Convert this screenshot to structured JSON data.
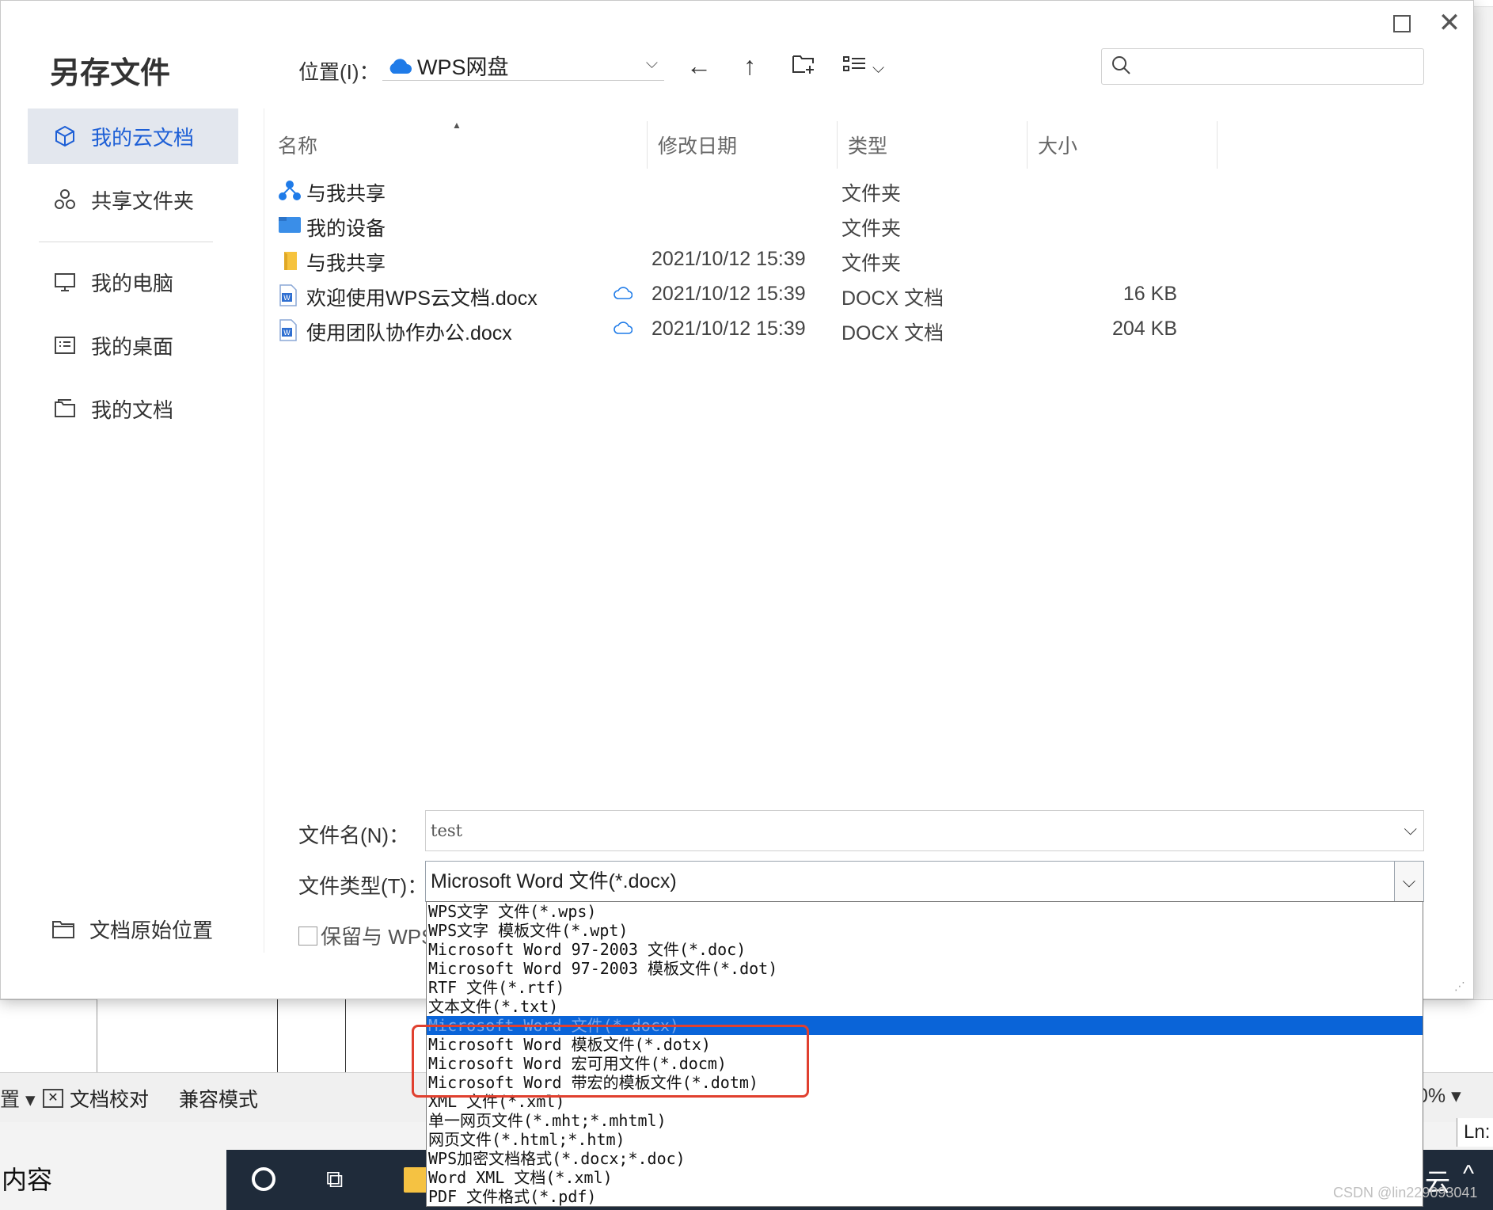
{
  "background": {
    "status_left": "置 ▾",
    "proofread_label": "文档校对",
    "compat_label": "兼容模式",
    "zoom_label": "0% ▾",
    "ln_label": "Ln:",
    "taskbar_search": "内容",
    "taskbar_right": "云"
  },
  "dialog": {
    "title": "另存文件",
    "sidebar": [
      {
        "label": "我的云文档",
        "icon": "cube-icon",
        "active": true
      },
      {
        "label": "共享文件夹",
        "icon": "share-nodes-icon",
        "active": false
      },
      {
        "label": "我的电脑",
        "icon": "monitor-icon",
        "active": false
      },
      {
        "label": "我的桌面",
        "icon": "desktop-icon",
        "active": false
      },
      {
        "label": "我的文档",
        "icon": "documents-icon",
        "active": false
      }
    ],
    "original_location_label": "文档原始位置",
    "location": {
      "label": "位置(I)：",
      "value": "WPS网盘"
    },
    "search": {
      "placeholder": ""
    },
    "columns": {
      "name": "名称",
      "modified": "修改日期",
      "type": "类型",
      "size": "大小"
    },
    "files": [
      {
        "name": "与我共享",
        "icon": "shared-people-icon",
        "sync": "",
        "modified": "",
        "type": "文件夹",
        "size": ""
      },
      {
        "name": "我的设备",
        "icon": "device-folder-icon",
        "sync": "",
        "modified": "",
        "type": "文件夹",
        "size": ""
      },
      {
        "name": "与我共享",
        "icon": "folder-icon",
        "sync": "",
        "modified": "2021/10/12 15:39",
        "type": "文件夹",
        "size": ""
      },
      {
        "name": "欢迎使用WPS云文档.docx",
        "icon": "word-doc-icon",
        "sync": "☁",
        "modified": "2021/10/12 15:39",
        "type": "DOCX 文档",
        "size": "16 KB"
      },
      {
        "name": "使用团队协作办公.docx",
        "icon": "word-doc-icon",
        "sync": "☁",
        "modified": "2021/10/12 15:39",
        "type": "DOCX 文档",
        "size": "204 KB"
      }
    ],
    "filename": {
      "label": "文件名(N)：",
      "value": "test"
    },
    "filetype": {
      "label": "文件类型(T)：",
      "value": "Microsoft Word 文件(*.docx)",
      "options": [
        "WPS文字 文件(*.wps)",
        "WPS文字 模板文件(*.wpt)",
        "Microsoft Word 97-2003 文件(*.doc)",
        "Microsoft Word 97-2003 模板文件(*.dot)",
        "RTF 文件(*.rtf)",
        "文本文件(*.txt)",
        "Microsoft Word 文件(*.docx)",
        "Microsoft Word 模板文件(*.dotx)",
        "Microsoft Word 宏可用文件(*.docm)",
        "Microsoft Word 带宏的模板文件(*.dotm)",
        "XML 文件(*.xml)",
        "单一网页文件(*.mht;*.mhtml)",
        "网页文件(*.html;*.htm)",
        "WPS加密文档格式(*.docx;*.doc)",
        "Word XML 文档(*.xml)",
        "PDF 文件格式(*.pdf)"
      ],
      "selected_index": 6
    },
    "keep_label": "保留与 WPS"
  },
  "watermark": "CSDN @lin229093041",
  "colors": {
    "accent": "#1d5fd6",
    "selected_row": "#0a64d8",
    "highlight_border": "#e0402f"
  }
}
